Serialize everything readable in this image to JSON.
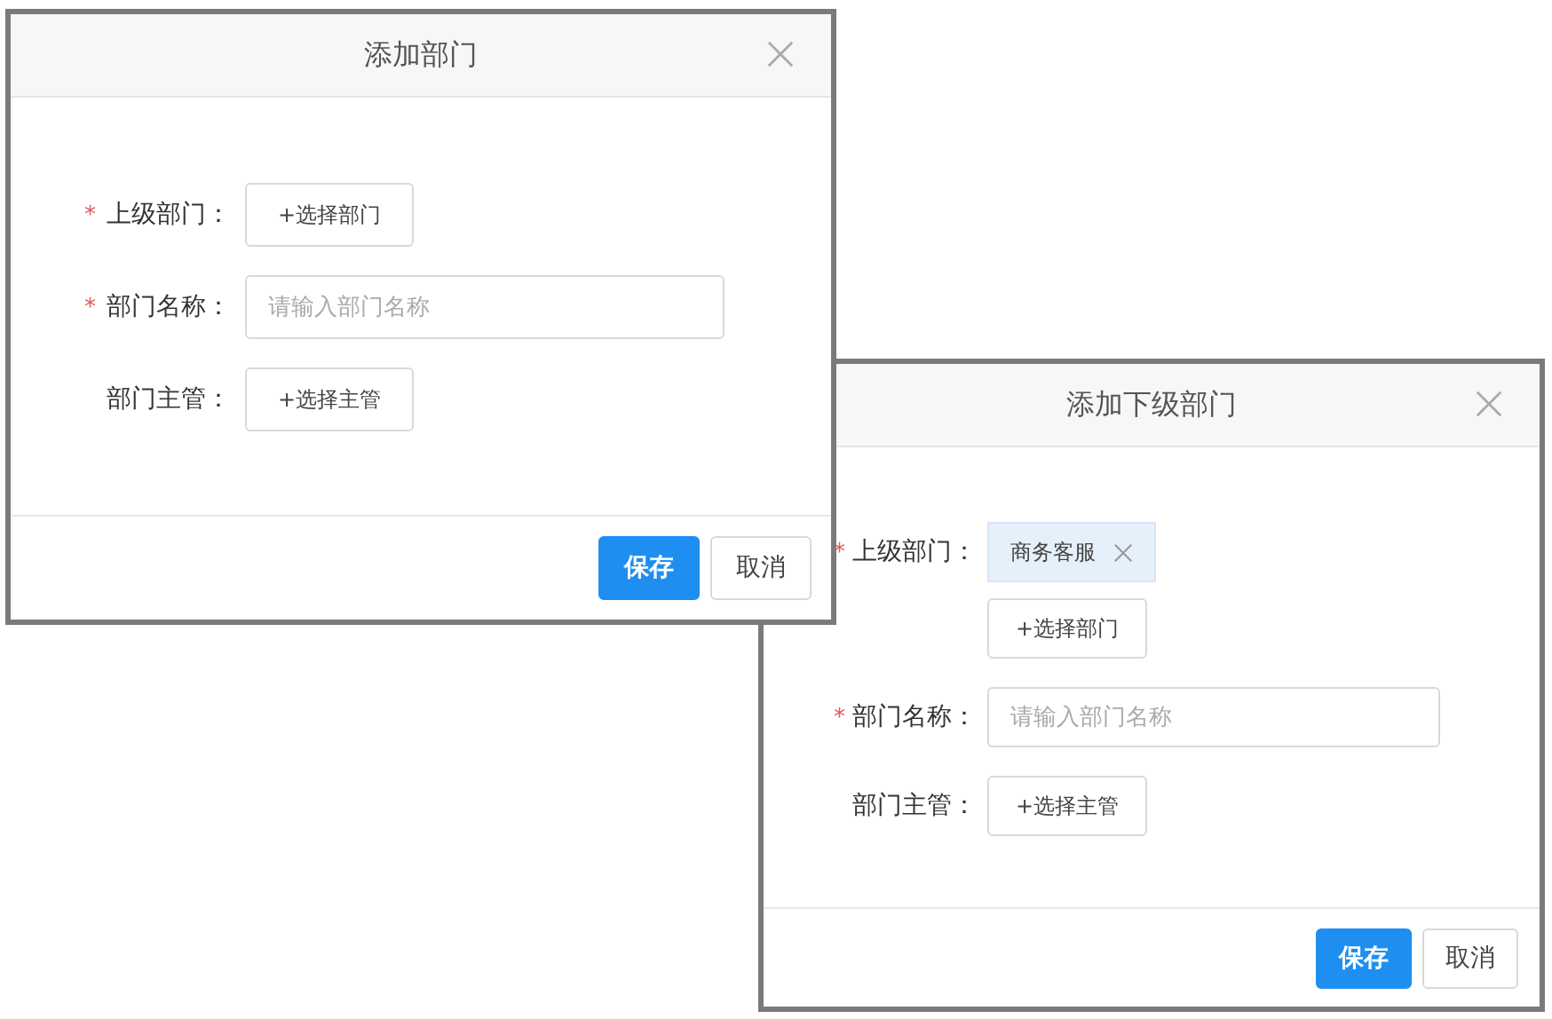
{
  "dialogs": [
    {
      "title": "添加部门",
      "fields": [
        {
          "label": "上级部门：",
          "required_mark": "*",
          "kind": "picker",
          "button": "+选择部门"
        },
        {
          "label": "部门名称：",
          "required_mark": "*",
          "kind": "input",
          "placeholder": "请输入部门名称"
        },
        {
          "label": "部门主管：",
          "kind": "picker",
          "button": "+选择主管"
        }
      ],
      "buttons": [
        {
          "label": "保存",
          "kind": "primary"
        },
        {
          "label": "取消",
          "kind": "default"
        }
      ]
    },
    {
      "title": "添加下级部门",
      "fields": [
        {
          "label": "上级部门：",
          "required_mark": "*",
          "kind": "picker",
          "tags": [
            "商务客服"
          ],
          "button": "+选择部门"
        },
        {
          "label": "部门名称：",
          "required_mark": "*",
          "kind": "input",
          "placeholder": "请输入部门名称"
        },
        {
          "label": "部门主管：",
          "kind": "picker",
          "button": "+选择主管"
        }
      ],
      "buttons": [
        {
          "label": "保存",
          "kind": "primary"
        },
        {
          "label": "取消",
          "kind": "default"
        }
      ]
    }
  ]
}
